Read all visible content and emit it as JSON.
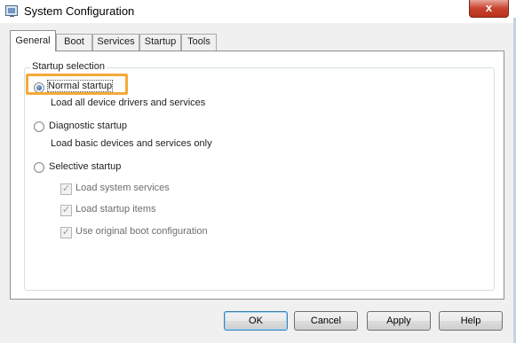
{
  "window": {
    "title": "System Configuration",
    "close_glyph": "x"
  },
  "tabs": [
    {
      "label": "General",
      "active": true
    },
    {
      "label": "Boot",
      "active": false
    },
    {
      "label": "Services",
      "active": false
    },
    {
      "label": "Startup",
      "active": false
    },
    {
      "label": "Tools",
      "active": false
    }
  ],
  "startup_selection": {
    "legend": "Startup selection",
    "normal": {
      "label": "Normal startup",
      "description": "Load all device drivers and services",
      "checked": true
    },
    "diagnostic": {
      "label": "Diagnostic startup",
      "description": "Load basic devices and services only",
      "checked": false
    },
    "selective": {
      "label": "Selective startup",
      "checked": false,
      "options": [
        {
          "label": "Load system services",
          "checked": true,
          "enabled": false
        },
        {
          "label": "Load startup items",
          "checked": true,
          "enabled": false
        },
        {
          "label": "Use original boot configuration",
          "checked": true,
          "enabled": false
        }
      ]
    }
  },
  "buttons": {
    "ok": "OK",
    "cancel": "Cancel",
    "apply": "Apply",
    "help": "Help"
  },
  "colors": {
    "highlight": "#f5a93a",
    "close_button": "#c7432e"
  }
}
